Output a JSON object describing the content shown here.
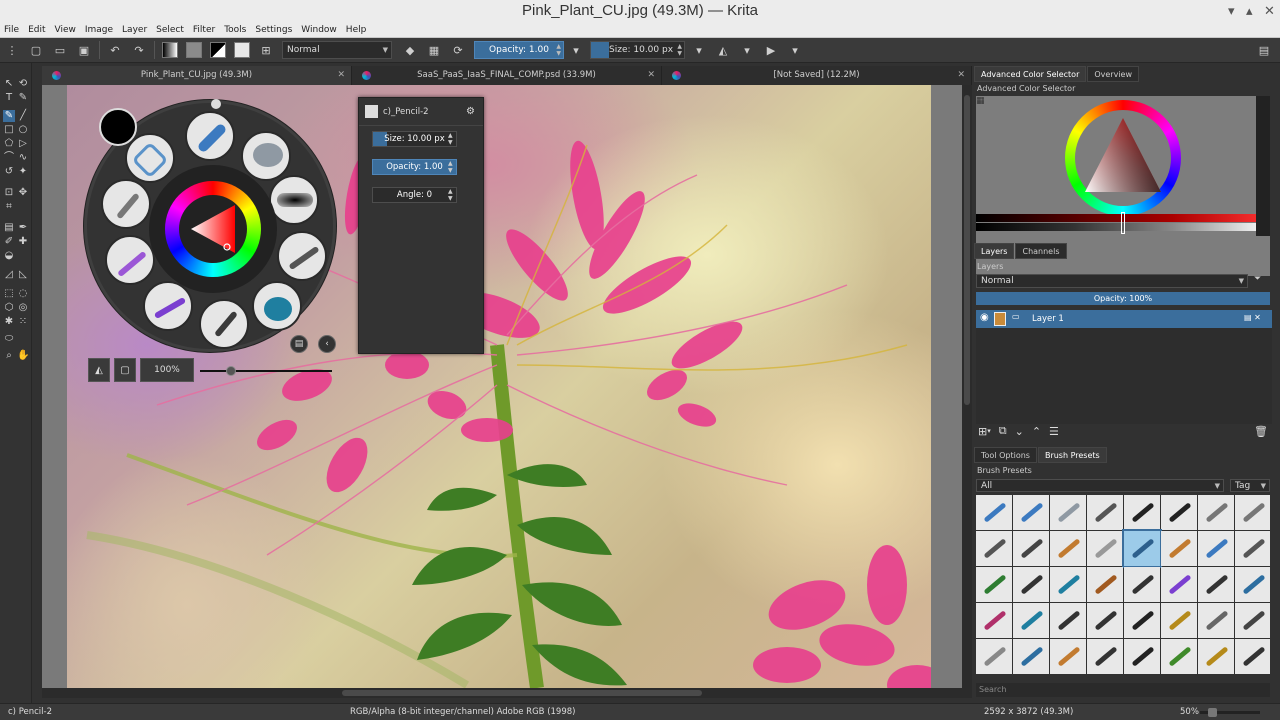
{
  "window": {
    "title": "Pink_Plant_CU.jpg (49.3M)  — Krita",
    "controls": [
      "▾",
      "▴",
      "✕"
    ]
  },
  "menu": [
    "File",
    "Edit",
    "View",
    "Image",
    "Layer",
    "Select",
    "Filter",
    "Tools",
    "Settings",
    "Window",
    "Help"
  ],
  "toolbar": {
    "blend_mode": "Normal",
    "opacity_label": "Opacity:  1.00",
    "size_label": "Size:  10.00 px"
  },
  "tabs": [
    {
      "label": "Pink_Plant_CU.jpg (49.3M)",
      "active": true
    },
    {
      "label": "SaaS_PaaS_IaaS_FINAL_COMP.psd (33.9M)",
      "active": false
    },
    {
      "label": "[Not Saved]  (12.2M)",
      "active": false
    }
  ],
  "popup_palette": {
    "zoom_label": "100%"
  },
  "brush_popup": {
    "name": "c)_Pencil-2",
    "size": "Size:  10.00 px",
    "opacity": "Opacity:  1.00",
    "angle": "Angle:  0"
  },
  "dock": {
    "color_tabs": [
      "Advanced Color Selector",
      "Overview"
    ],
    "color_title": "Advanced Color Selector",
    "layer_tabs": [
      "Layers",
      "Channels"
    ],
    "layers_title": "Layers",
    "layer_blend": "Normal",
    "layer_opacity": "Opacity:  100%",
    "layers": [
      {
        "name": "Layer 1",
        "visible": true
      }
    ],
    "lower_tabs": [
      "Tool Options",
      "Brush Presets"
    ],
    "presets_title": "Brush Presets",
    "presets_filter": "All",
    "presets_tag": "Tag",
    "search_placeholder": "Search"
  },
  "status": {
    "brush": "c) Pencil-2",
    "color_space": "RGB/Alpha (8-bit integer/channel)  Adobe RGB (1998)",
    "dimensions": "2592 x 3872 (49.3M)",
    "zoom": "50%"
  },
  "colors": {
    "accent": "#3b6e9c",
    "panel": "#313131",
    "foreground": "#000000"
  }
}
